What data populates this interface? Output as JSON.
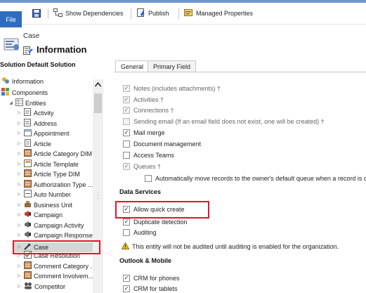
{
  "toolbar": {
    "file_label": "File",
    "show_dependencies": "Show Dependencies",
    "publish": "Publish",
    "managed_properties": "Managed Properties"
  },
  "header": {
    "entity_label": "Case",
    "title": "Information"
  },
  "sidebar": {
    "title": "Solution Default Solution",
    "information": "Information",
    "components": "Components",
    "entities": "Entities",
    "items": [
      "Activity",
      "Address",
      "Appointment",
      "Article",
      "Article Category DIM",
      "Article Template",
      "Article Type DIM",
      "Authorization Type ...",
      "Auto Number",
      "Business Unit",
      "Campaign",
      "Campaign Activity",
      "Campaign Response",
      "Case",
      "Case Resolution",
      "Comment Category ...",
      "Comment Involvem...",
      "Competitor"
    ]
  },
  "tabs": [
    "General",
    "Primary Field"
  ],
  "options": {
    "notes": "Notes (includes attachments) †",
    "activities": "Activities †",
    "connections": "Connections †",
    "sending_email": "Sending email (If an email field does not exist, one will be created) †",
    "mail_merge": "Mail merge",
    "document_management": "Document management",
    "access_teams": "Access Teams",
    "queues": "Queues †",
    "auto_move": "Automatically move records to the owner's default queue when a record is cr"
  },
  "data_services": {
    "title": "Data Services",
    "allow_quick_create": "Allow quick create",
    "duplicate_detection": "Duplicate detection",
    "auditing": "Auditing",
    "warning": "This entity will not be audited until auditing is enabled for the organization."
  },
  "outlook_mobile": {
    "title": "Outlook & Mobile",
    "crm_phones": "CRM for phones",
    "crm_tablets": "CRM for tablets"
  },
  "colors": {
    "accent": "#2d6cc0",
    "highlight_box": "#e0162b",
    "titlebar": "#7196cf"
  }
}
